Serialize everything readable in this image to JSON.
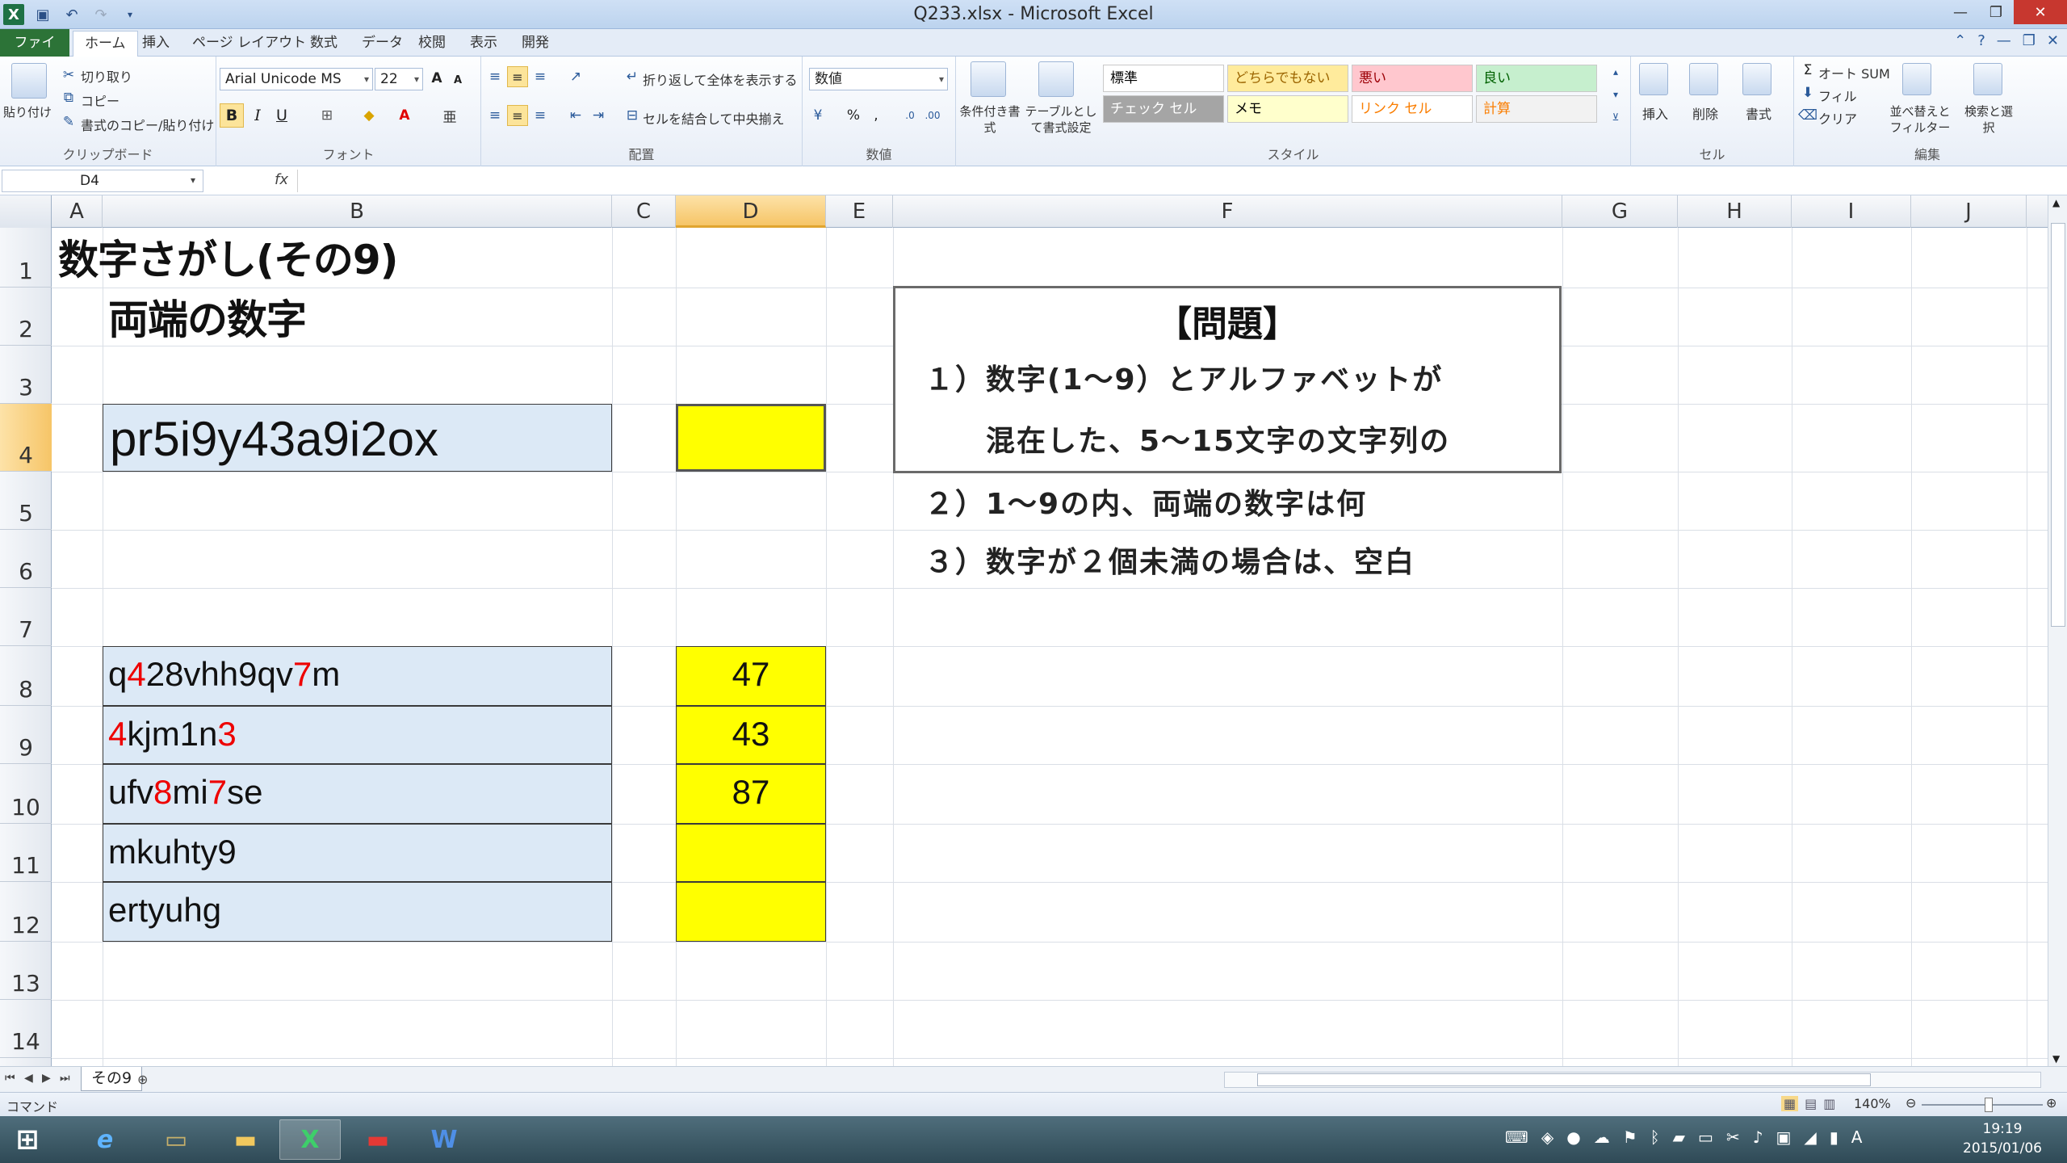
{
  "window": {
    "title": "Q233.xlsx - Microsoft Excel"
  },
  "ribbon_tabs": [
    "ファイル",
    "ホーム",
    "挿入",
    "ページ レイアウト",
    "数式",
    "データ",
    "校閲",
    "表示",
    "開発"
  ],
  "ribbon": {
    "clipboard": {
      "paste": "貼り付け",
      "cut": "切り取り",
      "copy": "コピー",
      "format_painter": "書式のコピー/貼り付け",
      "label": "クリップボード"
    },
    "font": {
      "name": "Arial Unicode MS",
      "size": "22",
      "label": "フォント",
      "bold": "B",
      "italic": "I",
      "underline": "U"
    },
    "alignment": {
      "wrap": "折り返して全体を表示する",
      "merge": "セルを結合して中央揃え",
      "label": "配置"
    },
    "number": {
      "format": "数値",
      "label": "数値"
    },
    "styles": {
      "conditional": "条件付き書式",
      "table": "テーブルとして書式設定",
      "label": "スタイル",
      "cells": [
        {
          "text": "標準",
          "bg": "#ffffff",
          "fg": "#000000"
        },
        {
          "text": "どちらでもない",
          "bg": "#ffeb9c",
          "fg": "#9c6500"
        },
        {
          "text": "悪い",
          "bg": "#ffc7ce",
          "fg": "#9c0006"
        },
        {
          "text": "良い",
          "bg": "#c6efce",
          "fg": "#006100"
        },
        {
          "text": "チェック セル",
          "bg": "#a5a5a5",
          "fg": "#ffffff"
        },
        {
          "text": "メモ",
          "bg": "#ffffcc",
          "fg": "#000000"
        },
        {
          "text": "リンク セル",
          "bg": "#ffffff",
          "fg": "#fa7d00"
        },
        {
          "text": "計算",
          "bg": "#f2f2f2",
          "fg": "#fa7d00"
        }
      ]
    },
    "cells_group": {
      "insert": "挿入",
      "delete": "削除",
      "format": "書式",
      "label": "セル"
    },
    "editing": {
      "autosum": "オート SUM",
      "fill": "フィル",
      "clear": "クリア",
      "sort": "並べ替えとフィルター",
      "find": "検索と選択",
      "label": "編集"
    }
  },
  "formula_bar": {
    "name_box": "D4",
    "fx": "fx",
    "content": ""
  },
  "columns": [
    "A",
    "B",
    "C",
    "D",
    "E",
    "F",
    "G",
    "H",
    "I",
    "J"
  ],
  "selected_column": "D",
  "rows": [
    "1",
    "2",
    "3",
    "4",
    "5",
    "6",
    "7",
    "8",
    "9",
    "10",
    "11",
    "12",
    "13",
    "14"
  ],
  "selected_row": "4",
  "sheet": {
    "title1": "数字さがし(その9)",
    "title2": "両端の数字",
    "question_cell": "pr5i9y43a9i2ox",
    "examples": [
      {
        "parts": [
          [
            "q",
            false
          ],
          [
            "4",
            true
          ],
          [
            "28vhh9qv",
            false
          ],
          [
            "7",
            true
          ],
          [
            "m",
            false
          ]
        ],
        "answer": "47"
      },
      {
        "parts": [
          [
            "4",
            true
          ],
          [
            "kjm1n",
            false
          ],
          [
            "3",
            true
          ]
        ],
        "answer": "43"
      },
      {
        "parts": [
          [
            "ufv",
            false
          ],
          [
            "8",
            true
          ],
          [
            "mi",
            false
          ],
          [
            "7",
            true
          ],
          [
            "se",
            false
          ]
        ],
        "answer": "87"
      },
      {
        "parts": [
          [
            "mkuhty9",
            false
          ]
        ],
        "answer": ""
      },
      {
        "parts": [
          [
            "ertyuhg",
            false
          ]
        ],
        "answer": ""
      }
    ],
    "problem": {
      "title": "【問題】",
      "lines": [
        "１）数字(1～9）とアルファベットが",
        "　　混在した、5～15文字の文字列の",
        "２）1～9の内、両端の数字は何",
        "３）数字が２個未満の場合は、空白"
      ]
    }
  },
  "sheet_tab": "その9",
  "status": {
    "mode": "コマンド",
    "zoom": "140%"
  },
  "clock": {
    "time": "19:19",
    "date": "2015/01/06"
  }
}
